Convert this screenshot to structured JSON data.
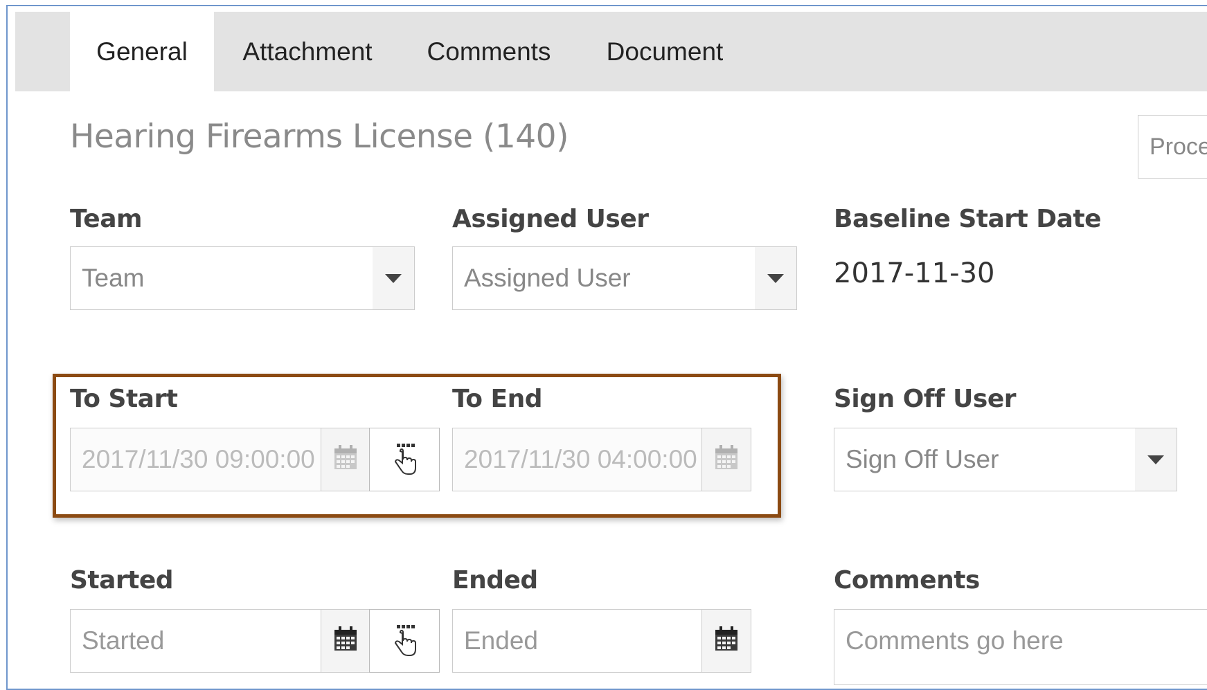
{
  "tabs": [
    {
      "label": "General",
      "active": true
    },
    {
      "label": "Attachment",
      "active": false
    },
    {
      "label": "Comments",
      "active": false
    },
    {
      "label": "Document",
      "active": false
    }
  ],
  "title": "Hearing Firearms License (140)",
  "process_dropdown": {
    "value": "Proce"
  },
  "fields": {
    "team": {
      "label": "Team",
      "placeholder": "Team"
    },
    "assigned_user": {
      "label": "Assigned User",
      "placeholder": "Assigned User"
    },
    "baseline_start_date": {
      "label": "Baseline Start Date",
      "value": "2017-11-30"
    },
    "to_start": {
      "label": "To Start",
      "value": "2017/11/30 09:00:00 /"
    },
    "to_end": {
      "label": "To End",
      "value": "2017/11/30 04:00:00 I"
    },
    "sign_off_user": {
      "label": "Sign Off User",
      "placeholder": "Sign Off User"
    },
    "started": {
      "label": "Started",
      "placeholder": "Started"
    },
    "ended": {
      "label": "Ended",
      "placeholder": "Ended"
    },
    "comments": {
      "label": "Comments",
      "placeholder": "Comments go here"
    }
  },
  "icons": {
    "calendar": "calendar-icon",
    "hand": "hand-pointer-icon",
    "dropdown": "chevron-down-icon"
  },
  "colors": {
    "highlight_border": "#8b4a12",
    "tab_bar": "#e3e3e3",
    "frame_border": "#6f96cc"
  }
}
